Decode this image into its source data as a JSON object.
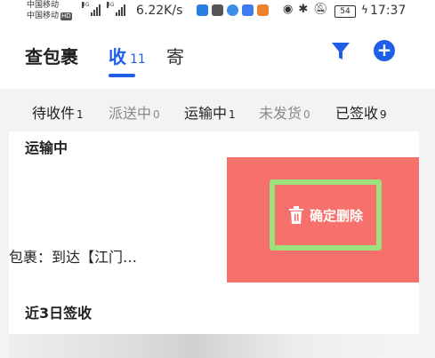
{
  "status_bar": {
    "carrier1": "中国移动",
    "carrier2": "中国移动",
    "carrier2_badge": "HD",
    "net1": "4G",
    "net2": "4G",
    "speed": "6.22K/s",
    "battery": "54",
    "time": "17:37"
  },
  "header": {
    "title": "查包裹",
    "tab_receive": "收",
    "tab_receive_count": "11",
    "tab_send": "寄",
    "accent_color": "#1f5fe8"
  },
  "filters": [
    {
      "label": "待收件",
      "count": "1"
    },
    {
      "label": "派送中",
      "count": "0"
    },
    {
      "label": "运输中",
      "count": "1"
    },
    {
      "label": "未发货",
      "count": "0"
    },
    {
      "label": "已签收",
      "count": "9"
    }
  ],
  "section_in_transit": {
    "title": "运输中",
    "package_text": "包裹：到达【江门…",
    "delete_label": "确定删除",
    "delete_bg_color": "#f6706c"
  },
  "section_recent": {
    "title": "近3日签收"
  }
}
